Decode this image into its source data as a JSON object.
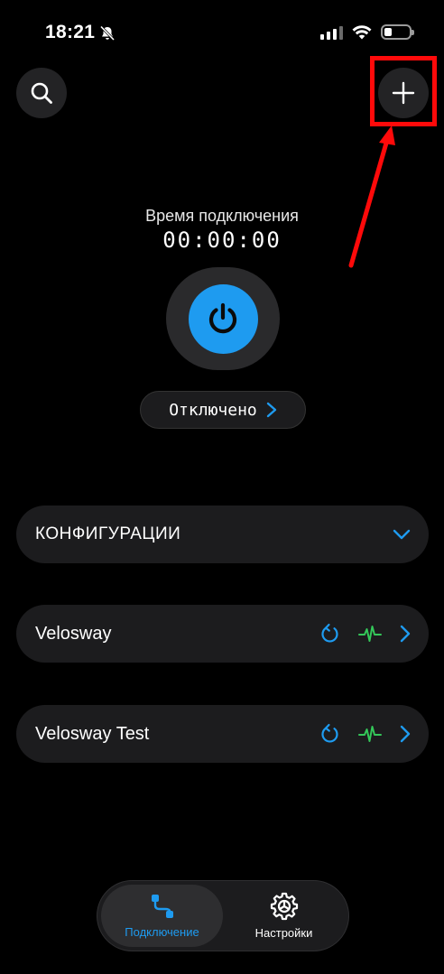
{
  "status_bar": {
    "time": "18:21",
    "icons": [
      "bell-slash-icon",
      "cellular-signal-icon",
      "wifi-icon",
      "battery-icon"
    ]
  },
  "header": {
    "search_icon": "search-icon",
    "add_icon": "plus-icon"
  },
  "connection": {
    "label": "Время подключения",
    "timer": "00:00:00",
    "status": "Отключено",
    "accent": "#1e9bf0"
  },
  "configs": {
    "header": "КОНФИГУРАЦИИ",
    "items": [
      {
        "name": "Velosway"
      },
      {
        "name": "Velosway Test"
      }
    ]
  },
  "tabbar": {
    "tabs": [
      {
        "label": "Подключение",
        "icon": "connection-icon",
        "active": true
      },
      {
        "label": "Настройки",
        "icon": "settings-gear-icon",
        "active": false
      }
    ]
  },
  "colors": {
    "background": "#000000",
    "card": "#1c1c1e",
    "accent": "#1e9bf0",
    "ping_green": "#34c759",
    "highlight_red": "#ff0a0a"
  }
}
